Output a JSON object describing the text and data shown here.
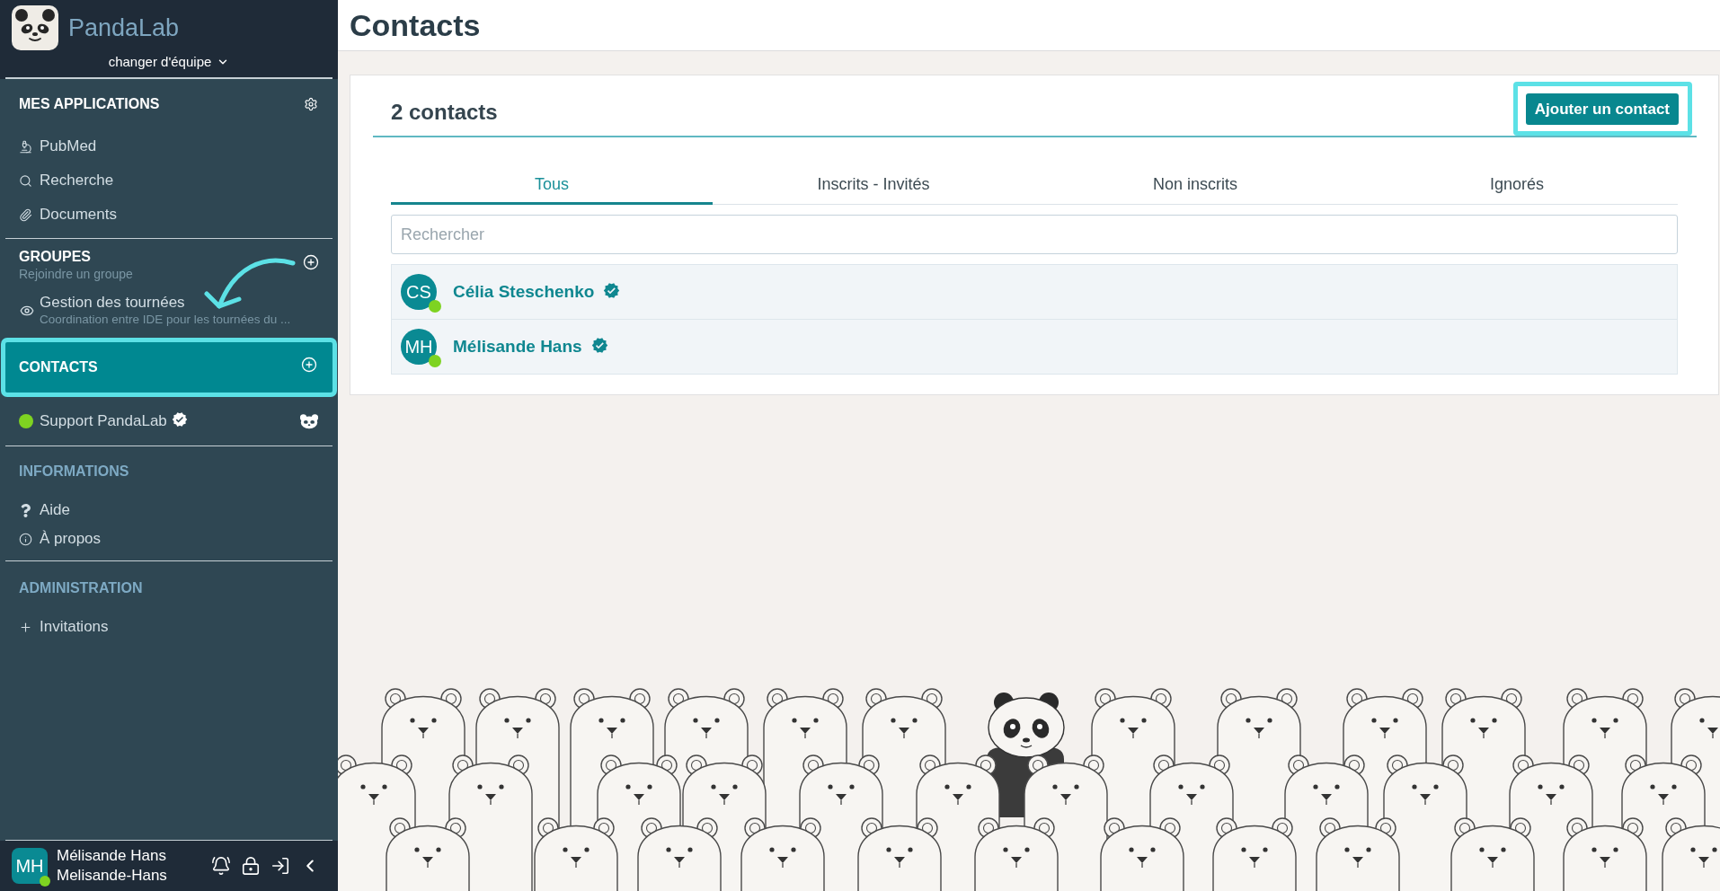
{
  "sidebar": {
    "brand": "PandaLab",
    "team_switcher": "changer d'équipe",
    "sections": [
      {
        "kind": "primary",
        "title": "MES APPLICATIONS",
        "selected": false,
        "highlighted": false,
        "items": [
          {
            "label": "PubMed"
          },
          {
            "label": "Recherche"
          },
          {
            "label": "Documents"
          }
        ]
      },
      {
        "kind": "primary",
        "title": "GROUPES",
        "subtitle": "Rejoindre un groupe",
        "selected": false,
        "highlighted": false,
        "items": [
          {
            "name": "Gestion des tournées",
            "description": "Coordination entre IDE pour les tournées du ..."
          }
        ]
      },
      {
        "kind": "primary",
        "title": "CONTACTS",
        "selected": true,
        "highlighted": true,
        "items": [
          {
            "name": "Support PandaLab",
            "online": true,
            "verified": true
          }
        ]
      },
      {
        "kind": "secondary",
        "title": "INFORMATIONS",
        "selected": false,
        "highlighted": false,
        "items": [
          {
            "label": "Aide"
          },
          {
            "label": "À propos"
          }
        ]
      },
      {
        "kind": "secondary",
        "title": "ADMINISTRATION",
        "selected": false,
        "highlighted": false,
        "items": [
          {
            "label": "Invitations"
          }
        ]
      }
    ]
  },
  "user": {
    "initials": "MH",
    "name": "Mélisande Hans",
    "username": "Melisande-Hans",
    "online": true
  },
  "page": {
    "title": "Contacts"
  },
  "contacts_card": {
    "count": "2 contacts",
    "add_button": {
      "label": "Ajouter un contact",
      "highlighted": true
    },
    "tabs": [
      {
        "label": "Tous",
        "selected": true
      },
      {
        "label": "Inscrits - Invités",
        "selected": false
      },
      {
        "label": "Non inscrits",
        "selected": false
      },
      {
        "label": "Ignorés",
        "selected": false
      }
    ],
    "search": {
      "placeholder": "Rechercher"
    },
    "contacts": [
      {
        "initials": "CS",
        "name": "Célia Steschenko",
        "online": true,
        "verified": true
      },
      {
        "initials": "MH",
        "name": "Mélisande Hans",
        "online": true,
        "verified": true
      }
    ]
  }
}
